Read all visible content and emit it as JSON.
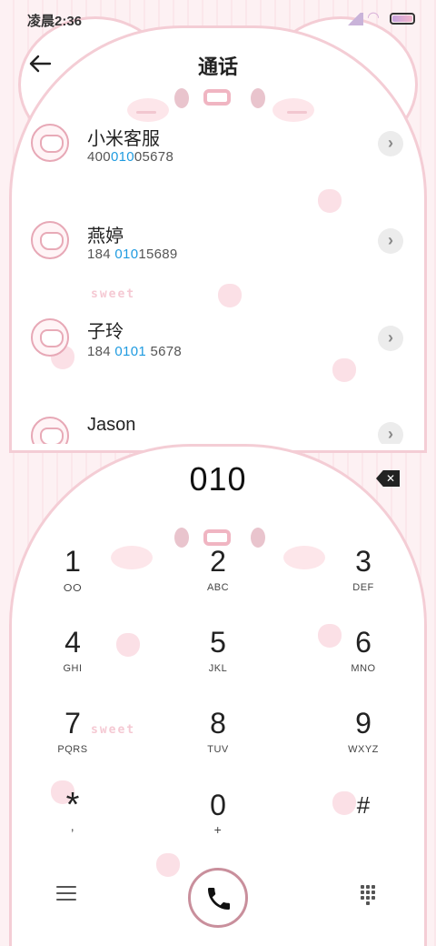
{
  "status_bar": {
    "time": "凌晨2:36",
    "icons": [
      "signal-icon",
      "wifi-icon",
      "battery-icon"
    ]
  },
  "header": {
    "title": "通话",
    "back_icon": "arrow-left-icon"
  },
  "contacts": [
    {
      "name": "小米客服",
      "number_pre": "400",
      "number_hl": "010",
      "number_post": "05678"
    },
    {
      "name": "燕婷",
      "number_pre": "184 ",
      "number_hl": "010",
      "number_post": "15689"
    },
    {
      "name": "子玲",
      "number_pre": "184 ",
      "number_hl": "0101",
      "number_post": " 5678"
    },
    {
      "name": "Jason",
      "number_pre": "",
      "number_hl": "",
      "number_post": ""
    }
  ],
  "dialer": {
    "input": "010",
    "keys": [
      {
        "digit": "1",
        "letters": "ⵔⵔ"
      },
      {
        "digit": "2",
        "letters": "ABC"
      },
      {
        "digit": "3",
        "letters": "DEF"
      },
      {
        "digit": "4",
        "letters": "GHI"
      },
      {
        "digit": "5",
        "letters": "JKL"
      },
      {
        "digit": "6",
        "letters": "MNO"
      },
      {
        "digit": "7",
        "letters": "PQRS"
      },
      {
        "digit": "8",
        "letters": "TUV"
      },
      {
        "digit": "9",
        "letters": "WXYZ"
      },
      {
        "digit": "*",
        "letters": ","
      },
      {
        "digit": "0",
        "letters": "+"
      },
      {
        "digit": "#",
        "letters": ""
      }
    ]
  },
  "decor": {
    "sweet_text": "sweet"
  },
  "colors": {
    "highlight": "#1f9be0",
    "accent_pink": "#f4cdd5",
    "call_ring": "#c98f9c"
  }
}
